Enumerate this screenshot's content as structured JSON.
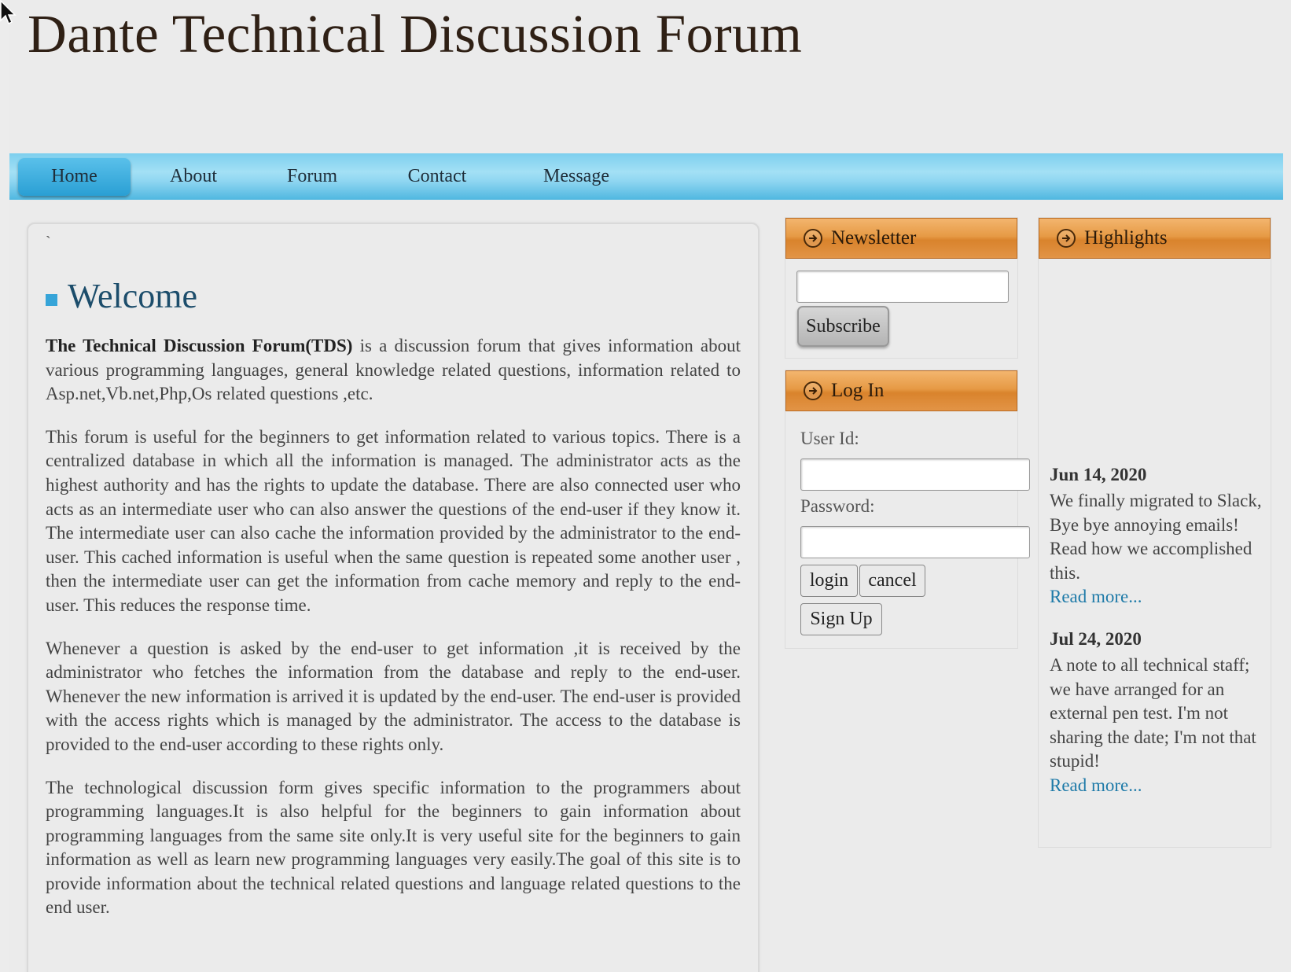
{
  "site": {
    "title": "Dante Technical Discussion Forum"
  },
  "nav": {
    "items": [
      "Home",
      "About",
      "Forum",
      "Contact",
      "Message"
    ],
    "active": "Home"
  },
  "main": {
    "stray_mark": "`",
    "heading": "Welcome",
    "intro_bold": "The Technical Discussion Forum(TDS)",
    "intro_rest": " is a discussion forum that gives information about various programming languages, general knowledge related questions, information related to Asp.net,Vb.net,Php,Os related questions ,etc.",
    "paragraphs": [
      "This forum is useful for the beginners to get information related to various topics. There is a centralized database in which all the information is managed. The administrator acts as the highest authority and has the rights to update the database. There are also connected user who acts as an intermediate user who can also answer the questions of the end-user if they know it. The intermediate user can also cache the information provided by the administrator to the end-user. This cached information is useful when the same question is repeated some another user , then the intermediate user can get the information from cache memory and reply to the end-user. This reduces the response time.",
      "Whenever a question is asked by the end-user to get information ,it is received by the administrator who fetches the information from the database and reply to the end-user. Whenever the new information is arrived it is updated by the end-user. The end-user is provided with the access rights which is managed by the administrator. The access to the database is provided to the end-user according to these rights only.",
      "The technological discussion form gives specific information to the programmers about programming languages.It is also helpful for the beginners to gain information about programming languages from the same site only.It is very useful site for the beginners to gain information as well as learn new programming languages very easily.The goal of this site is to provide information about the technical related questions and language related questions to the end user."
    ]
  },
  "newsletter": {
    "title": "Newsletter",
    "input_value": "",
    "subscribe_label": "Subscribe"
  },
  "login": {
    "title": "Log In",
    "user_label": "User Id:",
    "password_label": "Password:",
    "login_label": "login",
    "cancel_label": "cancel",
    "signup_label": "Sign Up"
  },
  "highlights": {
    "title": "Highlights",
    "items": [
      {
        "date": "Jun 14, 2020",
        "text": "We finally migrated to Slack, Bye bye annoying emails! Read how we accomplished this.",
        "link": "Read more..."
      },
      {
        "date": "Jul 24, 2020",
        "text": "A note to all technical staff; we have arranged for an external pen test. I'm not sharing the date; I'm not that stupid!",
        "link": "Read more..."
      }
    ]
  },
  "colors": {
    "nav_blue": "#8fd6f1",
    "nav_active": "#2a9fd4",
    "widget_orange": "#e69a45",
    "heading_blue": "#1c4d6b",
    "link_blue": "#1e7aa8"
  }
}
